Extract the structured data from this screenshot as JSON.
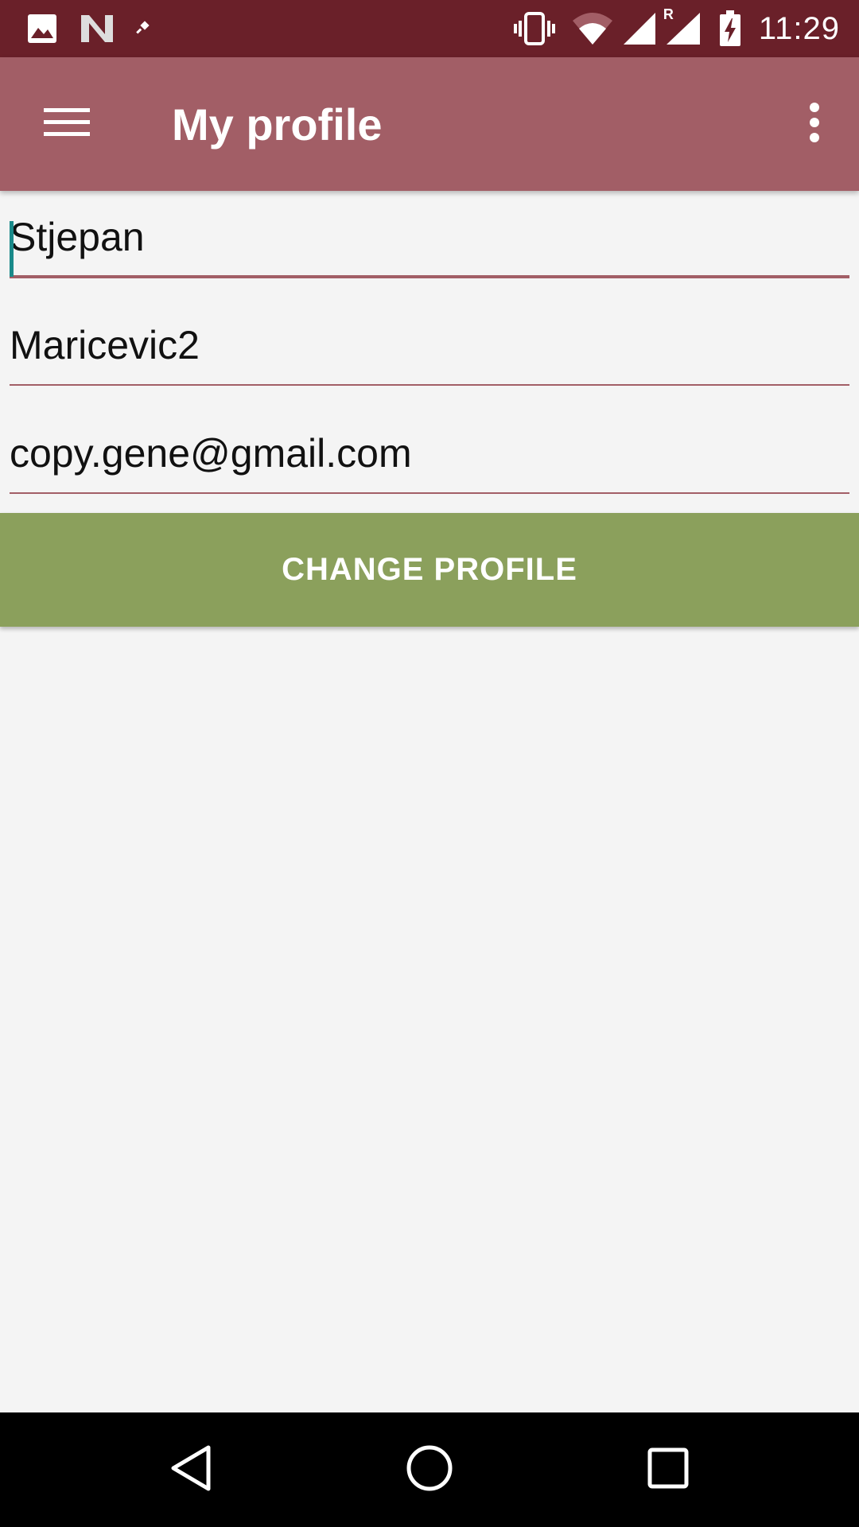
{
  "status_bar": {
    "time": "11:29",
    "left_icons": [
      "image-icon",
      "n-logo-icon",
      "pin-icon"
    ],
    "right_icons": [
      "vibrate-icon",
      "wifi-icon",
      "signal-icon",
      "roaming-signal-icon",
      "battery-charging-icon"
    ],
    "roaming_indicator": "R"
  },
  "app_bar": {
    "title": "My profile",
    "background": "#a25e66"
  },
  "form": {
    "first_name": "Stjepan",
    "last_name": "Maricevic2",
    "email": "copy.gene@gmail.com"
  },
  "actions": {
    "change_profile_label": "CHANGE PROFILE",
    "button_color": "#8ba05c"
  },
  "nav_bar": {
    "buttons": [
      "back-icon",
      "home-icon",
      "recents-icon"
    ]
  }
}
